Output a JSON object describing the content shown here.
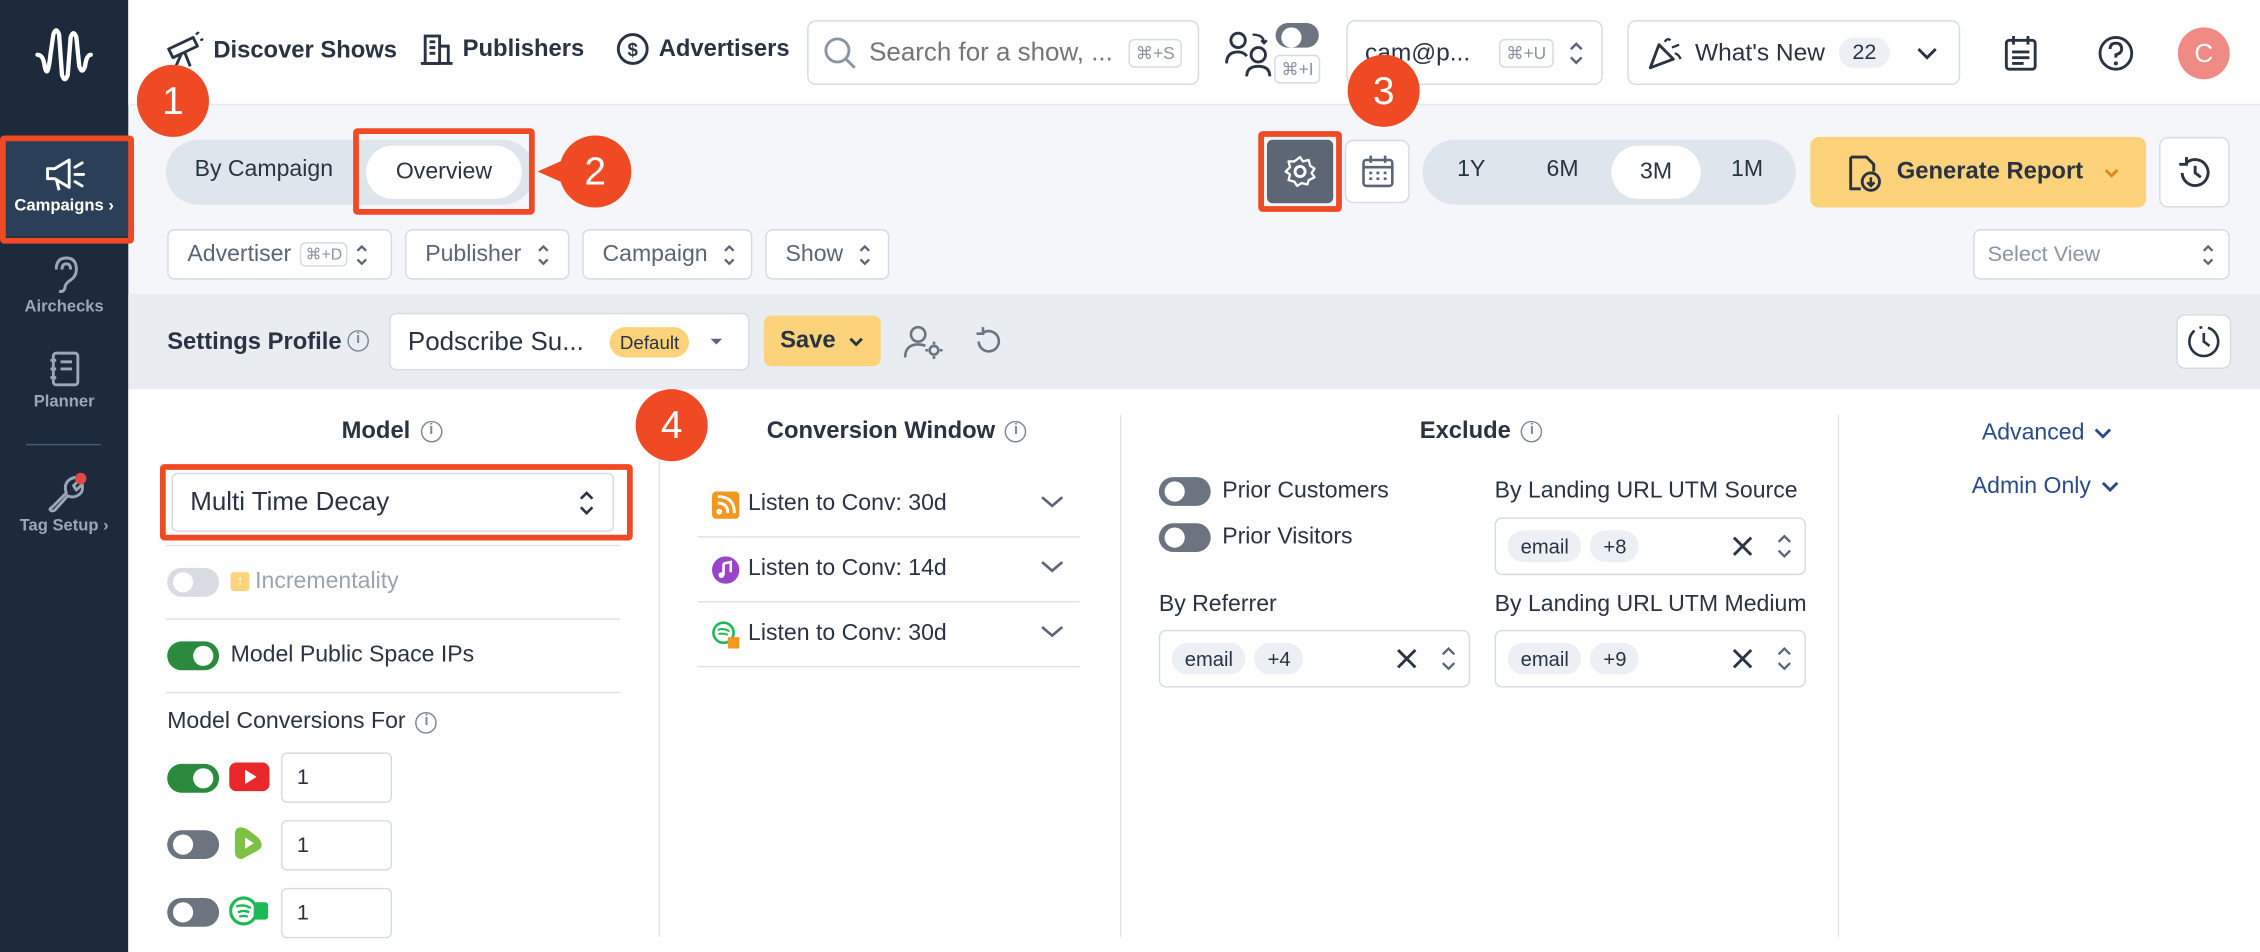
{
  "sidebar": {
    "items": [
      {
        "label": "Campaigns ›"
      },
      {
        "label": "Airchecks"
      },
      {
        "label": "Planner"
      },
      {
        "label": "Tag Setup ›"
      }
    ]
  },
  "topbar": {
    "nav": [
      "Discover Shows",
      "Publishers",
      "Advertisers"
    ],
    "search_placeholder": "Search for a show, ...",
    "search_shortcut": "⌘+S",
    "toggle_shortcut": "⌘+I",
    "account_value": "cam@p...",
    "account_shortcut": "⌘+U",
    "whats_new_label": "What's New",
    "whats_new_count": "22",
    "avatar_initial": "C"
  },
  "view_tabs": [
    "By Campaign",
    "Overview"
  ],
  "time_ranges": [
    "1Y",
    "6M",
    "3M",
    "1M"
  ],
  "selected_range": "3M",
  "generate_report_label": "Generate Report",
  "filters": [
    {
      "label": "Advertiser",
      "shortcut": "⌘+D"
    },
    {
      "label": "Publisher"
    },
    {
      "label": "Campaign"
    },
    {
      "label": "Show"
    }
  ],
  "select_view_placeholder": "Select View",
  "settings_profile": {
    "label": "Settings Profile",
    "profile_value": "Podscribe Su...",
    "default_tag": "Default",
    "save_label": "Save"
  },
  "model": {
    "title": "Model",
    "selected_model": "Multi Time Decay",
    "incrementality_label": "Incrementality",
    "model_public_space_label": "Model Public Space IPs",
    "conversions_title": "Model Conversions For",
    "conversions": [
      {
        "platform": "youtube",
        "value": "1",
        "on": true
      },
      {
        "platform": "rumble",
        "value": "1",
        "on": false
      },
      {
        "platform": "spotify-video",
        "value": "1",
        "on": false
      }
    ]
  },
  "conversion_window": {
    "title": "Conversion Window",
    "rows": [
      {
        "icon": "rss-icon",
        "label": "Listen to Conv: 30d"
      },
      {
        "icon": "podcasts-icon",
        "label": "Listen to Conv: 14d"
      },
      {
        "icon": "spotify-icon",
        "label": "Listen to Conv: 30d"
      }
    ]
  },
  "exclude": {
    "title": "Exclude",
    "prior_customers": "Prior Customers",
    "prior_visitors": "Prior Visitors",
    "by_referrer": {
      "label": "By Referrer",
      "chip": "email",
      "more": "+4"
    },
    "utm_source": {
      "label": "By Landing URL UTM Source",
      "chip": "email",
      "more": "+8"
    },
    "utm_medium": {
      "label": "By Landing URL UTM Medium",
      "chip": "email",
      "more": "+9"
    }
  },
  "advanced_label": "Advanced",
  "admin_only_label": "Admin Only",
  "callouts": [
    "1",
    "2",
    "3",
    "4"
  ],
  "colors": {
    "highlight": "#f04a25",
    "accent_yellow": "#fcd27a",
    "sidebar": "#1c2a3c",
    "toggle_on": "#2b8a3e"
  }
}
